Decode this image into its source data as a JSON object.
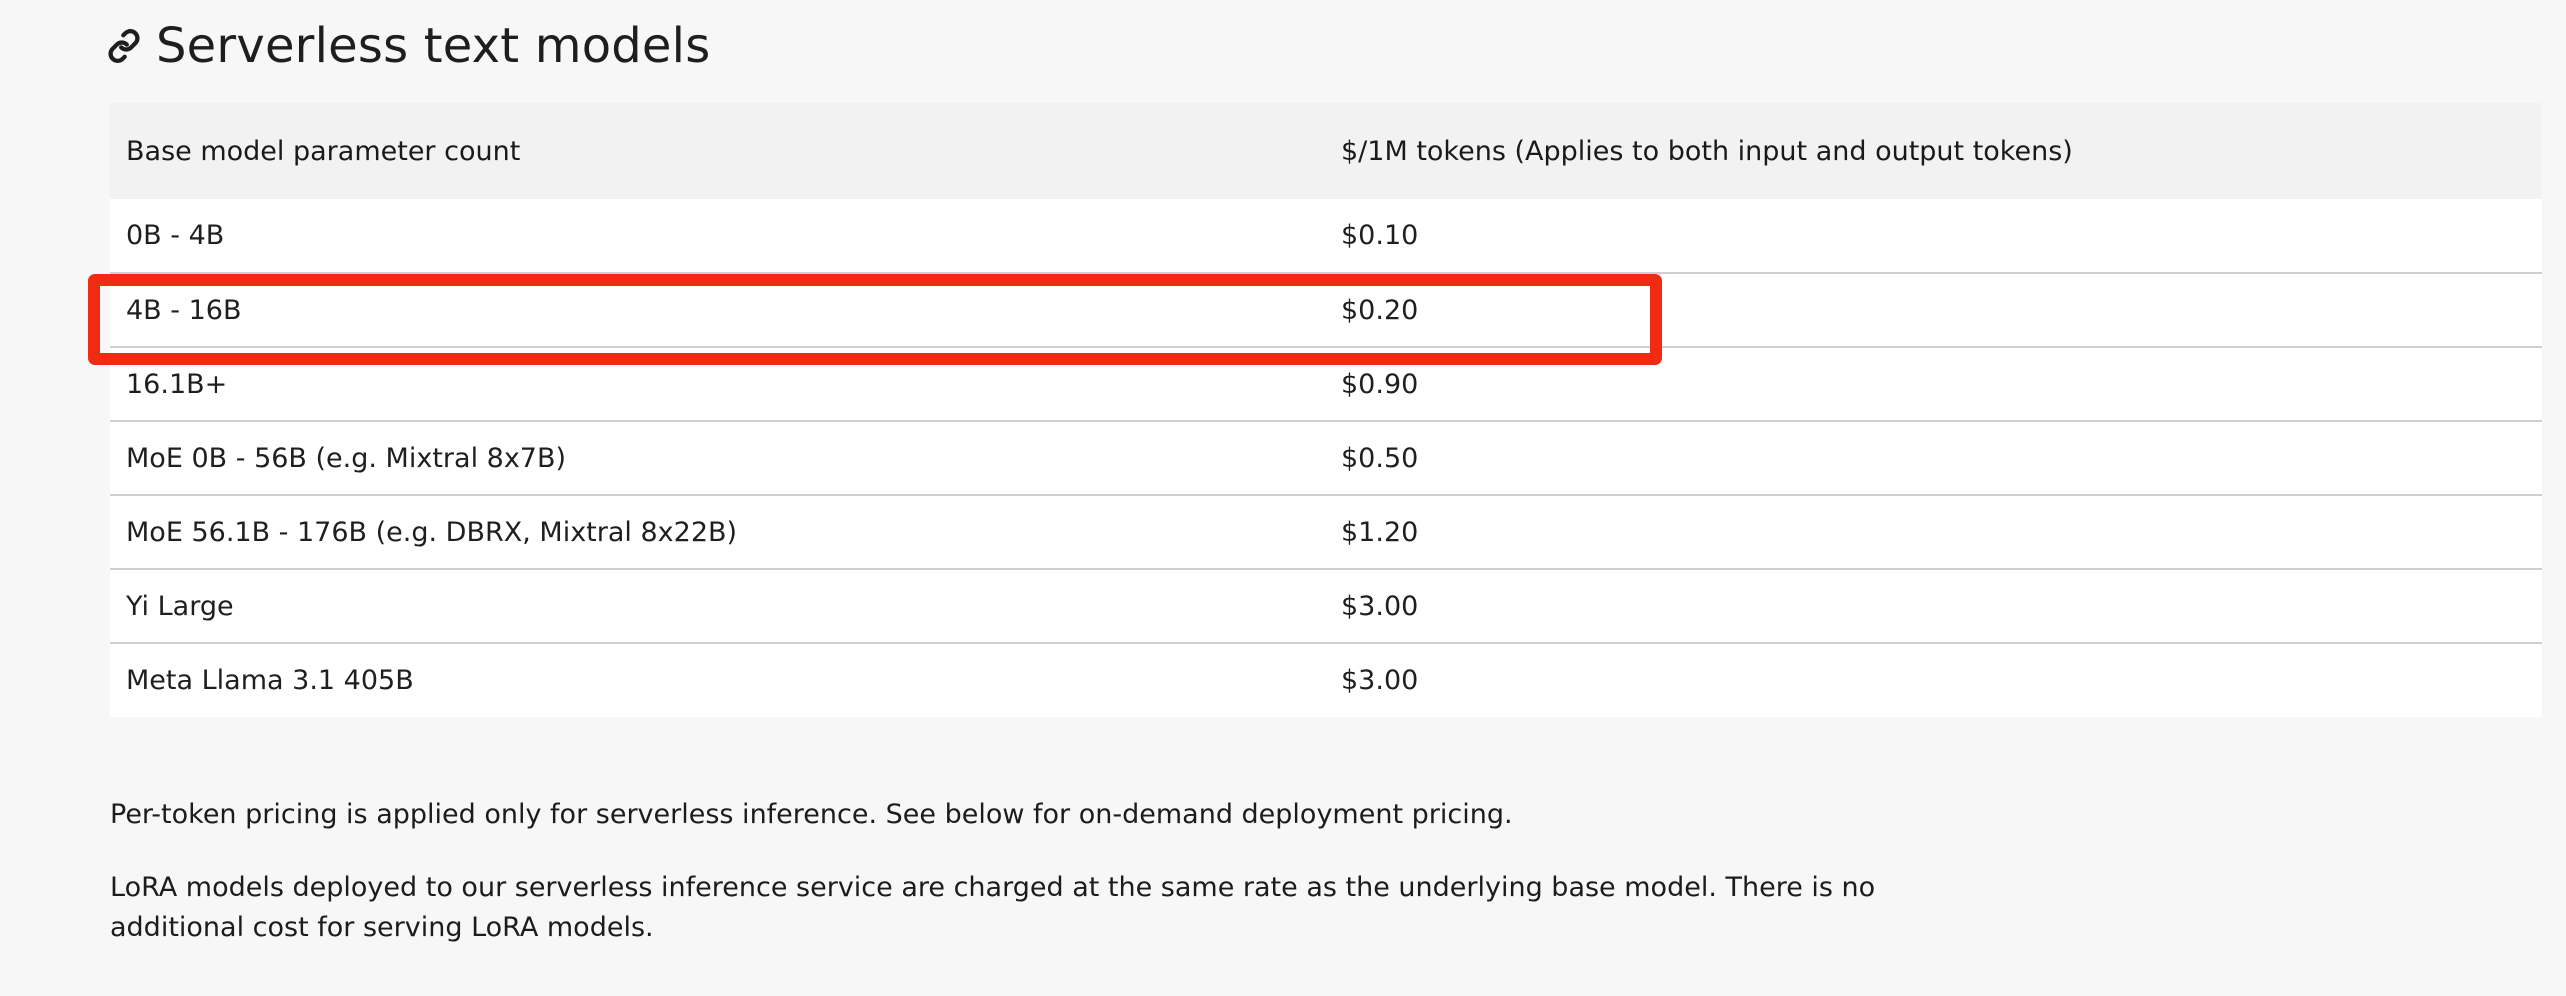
{
  "section": {
    "title": "Serverless text models",
    "icon": "link-icon"
  },
  "table": {
    "headers": {
      "model": "Base model parameter count",
      "price": "$/1M tokens (Applies to both input and output tokens)"
    },
    "rows": [
      {
        "model": "0B - 4B",
        "price": "$0.10"
      },
      {
        "model": "4B - 16B",
        "price": "$0.20",
        "highlighted": true
      },
      {
        "model": "16.1B+",
        "price": "$0.90"
      },
      {
        "model": "MoE 0B - 56B (e.g. Mixtral 8x7B)",
        "price": "$0.50"
      },
      {
        "model": "MoE 56.1B - 176B (e.g. DBRX, Mixtral 8x22B)",
        "price": "$1.20"
      },
      {
        "model": "Yi Large",
        "price": "$3.00"
      },
      {
        "model": "Meta Llama 3.1 405B",
        "price": "$3.00"
      }
    ]
  },
  "notes": {
    "per_token": "Per-token pricing is applied only for serverless inference. See below for on-demand deployment pricing.",
    "lora": "LoRA models deployed to our serverless inference service are charged at the same rate as the underlying base model. There is no additional cost for serving LoRA models."
  },
  "colors": {
    "highlight": "#f12a12",
    "background": "#f7f7f7",
    "header_row": "#f1f2f1",
    "row": "#ffffff",
    "divider": "#cfcfcf"
  }
}
